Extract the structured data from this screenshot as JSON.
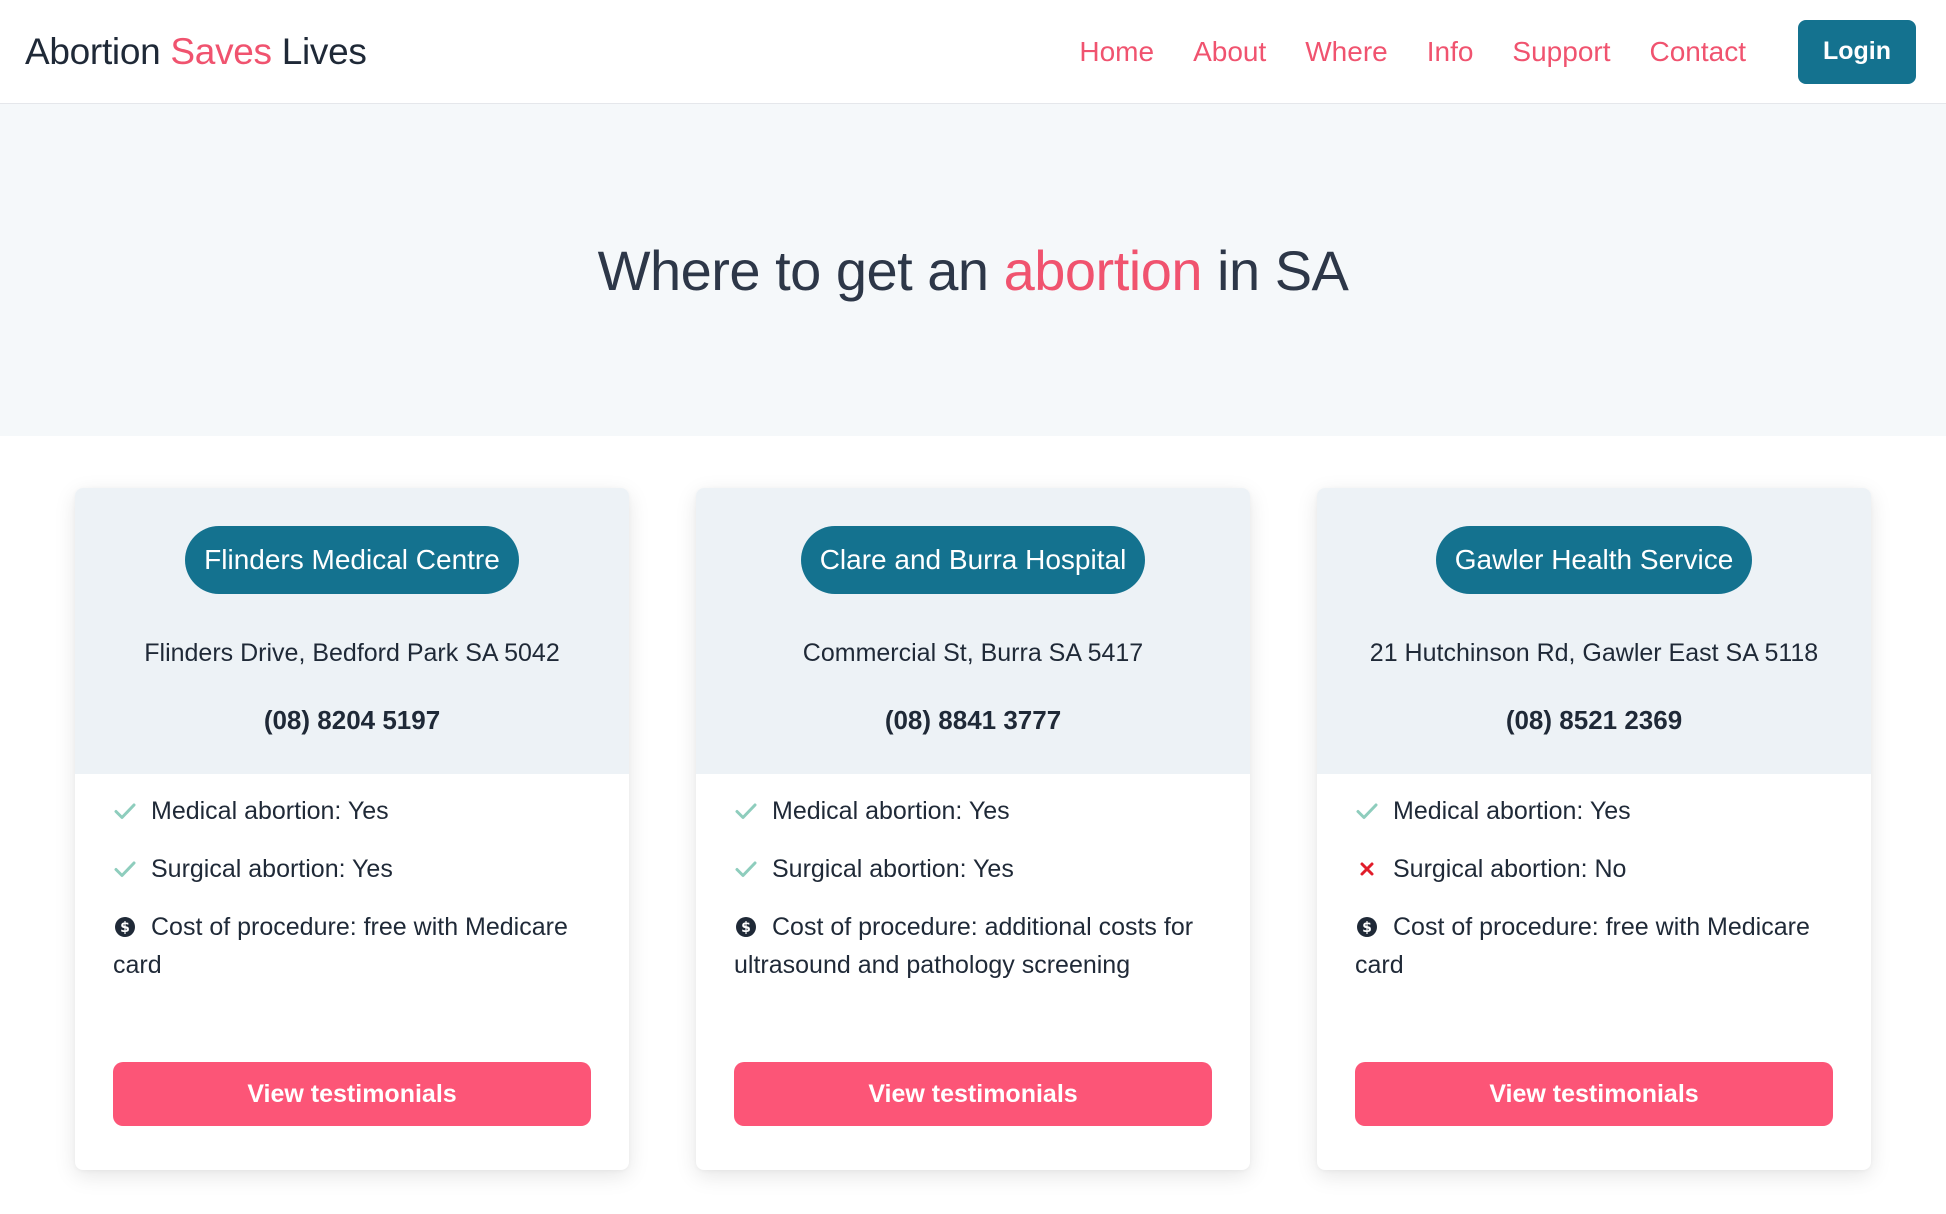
{
  "header": {
    "logo_part1": "Abortion",
    "logo_part2": "Saves",
    "logo_part3": "Lives",
    "nav": [
      "Home",
      "About",
      "Where",
      "Info",
      "Support",
      "Contact"
    ],
    "login_label": "Login"
  },
  "hero": {
    "title_pre": "Where to get an",
    "title_accent": "abortion",
    "title_post": "in SA"
  },
  "colors": {
    "accent_pink": "#f0536f",
    "button_pink": "#fc5577",
    "primary_teal": "#14728f",
    "check_green": "#8ecdbd",
    "cross_red": "#e11d2a"
  },
  "cards": [
    {
      "name": "Flinders Medical Centre",
      "address": "Flinders Drive, Bedford Park SA 5042",
      "phone": "(08) 8204 5197",
      "medical": "Medical abortion: Yes",
      "medical_icon": "check-icon",
      "surgical": "Surgical abortion: Yes",
      "surgical_icon": "check-icon",
      "cost": "Cost of procedure: free with Medicare card",
      "cost_icon": "dollar-icon",
      "button": "View testimonials"
    },
    {
      "name": "Clare and Burra Hospital",
      "address": "Commercial St, Burra SA 5417",
      "phone": "(08) 8841 3777",
      "medical": "Medical abortion: Yes",
      "medical_icon": "check-icon",
      "surgical": "Surgical abortion: Yes",
      "surgical_icon": "check-icon",
      "cost": "Cost of procedure: additional costs for ultrasound and pathology screening",
      "cost_icon": "dollar-icon",
      "button": "View testimonials"
    },
    {
      "name": "Gawler Health Service",
      "address": "21 Hutchinson Rd, Gawler East SA 5118",
      "phone": "(08) 8521 2369",
      "medical": "Medical abortion: Yes",
      "medical_icon": "check-icon",
      "surgical": "Surgical abortion: No",
      "surgical_icon": "cross-icon",
      "cost": "Cost of procedure: free with Medicare card",
      "cost_icon": "dollar-icon",
      "button": "View testimonials"
    }
  ]
}
